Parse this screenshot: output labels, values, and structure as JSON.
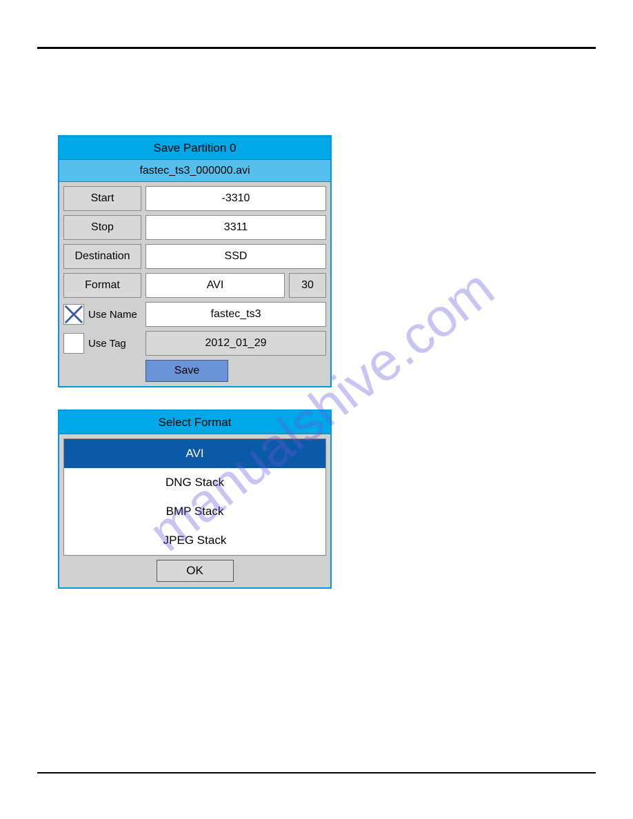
{
  "savePanel": {
    "title": "Save Partition 0",
    "filename": "fastec_ts3_000000.avi",
    "startLabel": "Start",
    "startValue": "-3310",
    "stopLabel": "Stop",
    "stopValue": "3311",
    "destLabel": "Destination",
    "destValue": "SSD",
    "formatLabel": "Format",
    "formatValue": "AVI",
    "formatNum": "30",
    "useNameLabel": "Use Name",
    "useNameValue": "fastec_ts3",
    "useNameChecked": true,
    "useTagLabel": "Use Tag",
    "useTagValue": "2012_01_29",
    "useTagChecked": false,
    "saveBtn": "Save"
  },
  "formatPanel": {
    "title": "Select Format",
    "items": [
      "AVI",
      "DNG Stack",
      "BMP Stack",
      "JPEG Stack"
    ],
    "selectedIndex": 0,
    "okBtn": "OK"
  },
  "watermark": "manualshive.com"
}
